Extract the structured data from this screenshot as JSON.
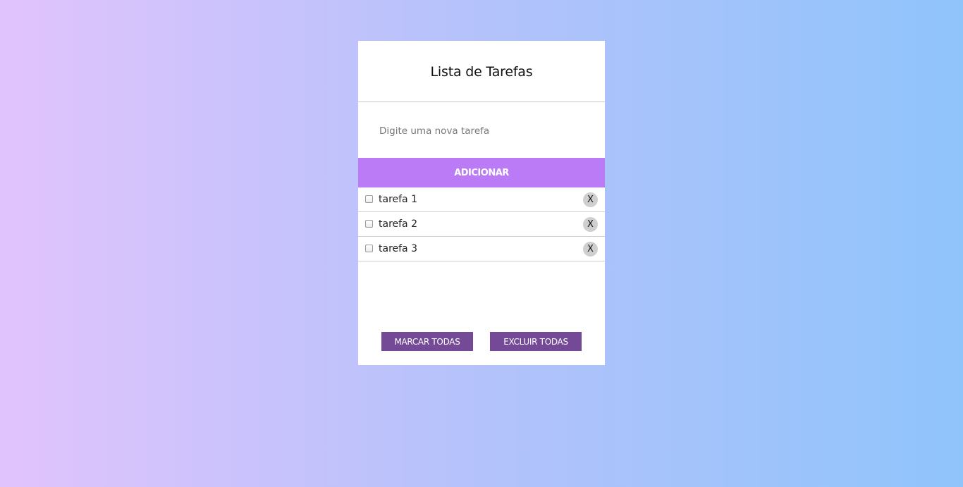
{
  "header": {
    "title": "Lista de Tarefas"
  },
  "input": {
    "placeholder": "Digite uma nova tarefa",
    "value": ""
  },
  "add_button": {
    "label": "ADICIONAR"
  },
  "tasks": [
    {
      "text": "tarefa 1",
      "checked": false,
      "delete_label": "X"
    },
    {
      "text": "tarefa 2",
      "checked": false,
      "delete_label": "X"
    },
    {
      "text": "tarefa 3",
      "checked": false,
      "delete_label": "X"
    }
  ],
  "actions": {
    "mark_all_label": "MARCAR TODAS",
    "delete_all_label": "EXCLUIR TODAS"
  },
  "colors": {
    "background_left": "#e1c3fc",
    "background_right": "#8fc4fb",
    "add_button": "#bb7af6",
    "action_button": "#744a97",
    "delete_button": "#cfcfcf"
  }
}
